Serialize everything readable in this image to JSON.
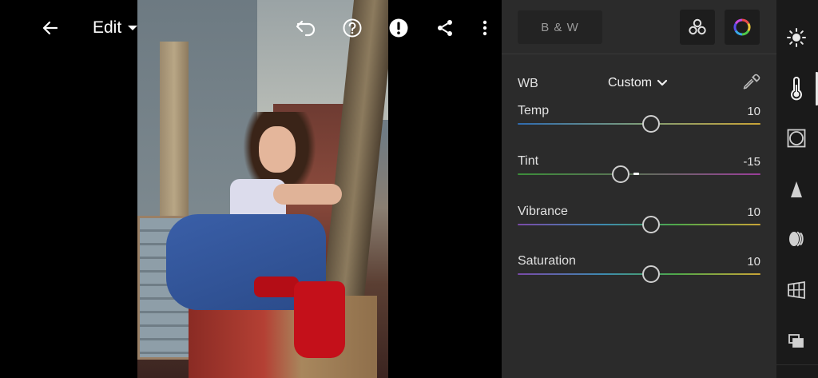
{
  "header": {
    "edit_label": "Edit"
  },
  "panel": {
    "bw_label": "B & W",
    "wb": {
      "label": "WB",
      "selected": "Custom"
    },
    "sliders": [
      {
        "label": "Temp",
        "value": "10",
        "level": 10,
        "min": -100,
        "max": 100
      },
      {
        "label": "Tint",
        "value": "-15",
        "level": -15,
        "min": -100,
        "max": 100
      },
      {
        "label": "Vibrance",
        "value": "10",
        "level": 10,
        "min": -100,
        "max": 100
      },
      {
        "label": "Saturation",
        "value": "10",
        "level": 10,
        "min": -100,
        "max": 100
      }
    ]
  },
  "colors": {
    "panel_bg": "#2b2b2b",
    "toolbar_bg": "#1a1a1a",
    "temp_track": [
      "#2f6bb0",
      "#c9a437"
    ],
    "tint_track": [
      "#3c8e3a",
      "#9a3d9a"
    ],
    "vibrance_track": [
      "#7a4aa8",
      "#3d8ab0",
      "#4fa84a",
      "#c9a437"
    ],
    "saturation_track": [
      "#7a4aa8",
      "#3d8ab0",
      "#4fa84a",
      "#c9a437"
    ]
  },
  "icons": {
    "toolbar": [
      "back-arrow-icon",
      "undo-icon",
      "help-icon",
      "alert-icon",
      "share-icon",
      "more-vertical-icon"
    ],
    "tools": [
      "light-icon",
      "color-temperature-icon",
      "effects-icon",
      "detail-icon",
      "optics-icon",
      "geometry-icon",
      "versions-icon"
    ]
  }
}
